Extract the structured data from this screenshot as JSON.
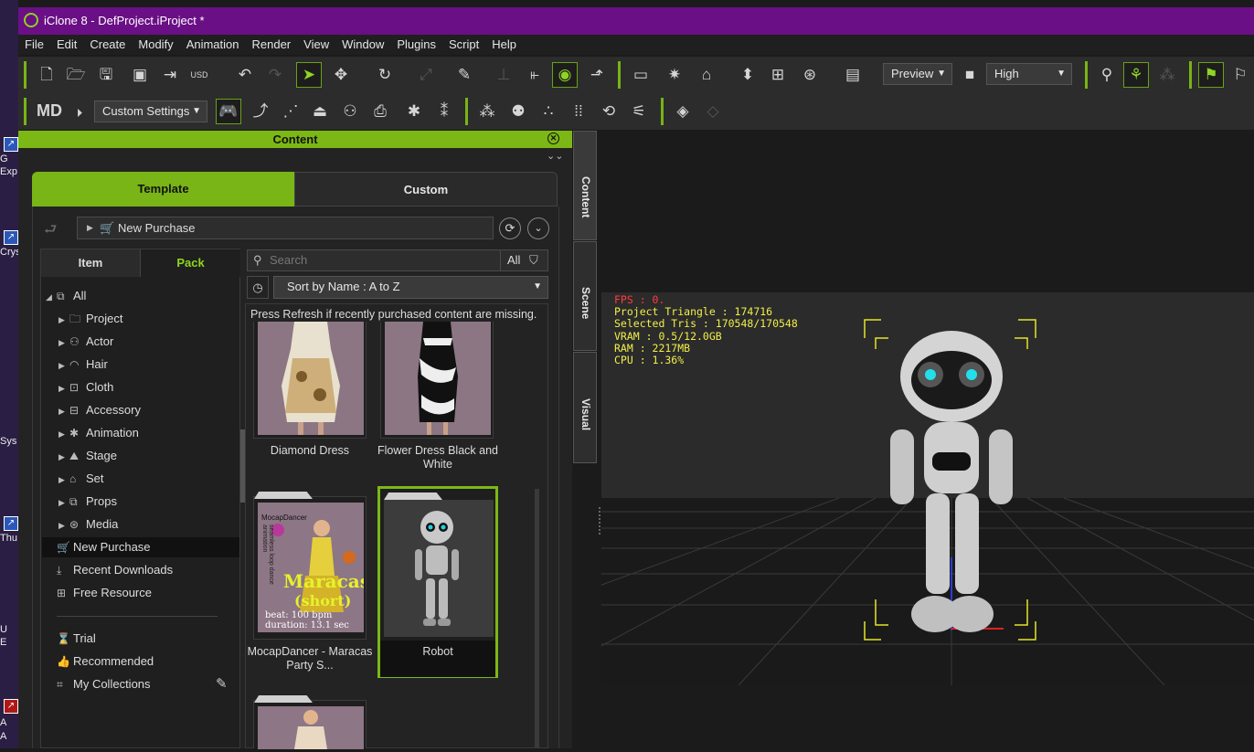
{
  "window": {
    "title": "iClone 8 - DefProject.iProject *"
  },
  "desktop_labels": [
    "G",
    "Exp",
    "Crys",
    "Sys",
    "Thu",
    "U",
    "E",
    "A",
    "A"
  ],
  "menu": [
    "File",
    "Edit",
    "Create",
    "Modify",
    "Animation",
    "Render",
    "View",
    "Window",
    "Plugins",
    "Script",
    "Help"
  ],
  "toolbar1": {
    "preview_label": "Preview",
    "quality_label": "High"
  },
  "toolbar2": {
    "settings_label": "Custom Settings"
  },
  "content_panel": {
    "title": "Content",
    "tabs": [
      "Template",
      "Custom"
    ],
    "active_tab": "Template",
    "path": "New Purchase",
    "subtabs": [
      "Item",
      "Pack"
    ],
    "active_subtab": "Pack",
    "tree": [
      {
        "label": "All",
        "icon": "all-icon"
      },
      {
        "label": "Project",
        "icon": "folder-icon"
      },
      {
        "label": "Actor",
        "icon": "actor-icon"
      },
      {
        "label": "Hair",
        "icon": "hair-icon"
      },
      {
        "label": "Cloth",
        "icon": "cloth-icon"
      },
      {
        "label": "Accessory",
        "icon": "accessory-icon"
      },
      {
        "label": "Animation",
        "icon": "animation-icon"
      },
      {
        "label": "Stage",
        "icon": "stage-icon"
      },
      {
        "label": "Set",
        "icon": "set-icon"
      },
      {
        "label": "Props",
        "icon": "props-icon"
      },
      {
        "label": "Media",
        "icon": "media-icon"
      }
    ],
    "quick_links": [
      "New Purchase",
      "Recent Downloads",
      "Free Resource"
    ],
    "selected_link": "New Purchase",
    "extra_links": [
      "Trial",
      "Recommended",
      "My Collections"
    ],
    "search_placeholder": "Search",
    "filter_label": "All",
    "sort_label": "Sort by Name : A to Z",
    "notice": "Press Refresh if recently purchased content are missing.",
    "items": [
      {
        "name": "Diamond Dress"
      },
      {
        "name": "Flower Dress Black and White"
      },
      {
        "name": "MocapDancer - Maracas Party S..."
      },
      {
        "name": "Robot",
        "selected": true
      }
    ],
    "thumb_texts": {
      "mocap_brand": "MocapDancer",
      "mocap_title": "Maracas",
      "mocap_sub": "(short)",
      "mocap_side": "seamless loop dance animation",
      "mocap_beat": "beat: 100 bpm",
      "mocap_duration": "duration: 13.1 sec"
    }
  },
  "side_tabs": [
    "Content",
    "Scene",
    "Visual"
  ],
  "viewport_stats": {
    "fps": "FPS : 0.",
    "triangles": "Project Triangle : 174716",
    "selected": "Selected Tris : 170548/170548",
    "vram": "VRAM : 0.5/12.0GB",
    "ram": "RAM : 2217MB",
    "cpu": "CPU : 1.36%"
  },
  "colors": {
    "accent": "#7cb815",
    "titlebar": "#6a0f86",
    "stats": "#f2ef4a",
    "fps": "#ff3b3b"
  }
}
